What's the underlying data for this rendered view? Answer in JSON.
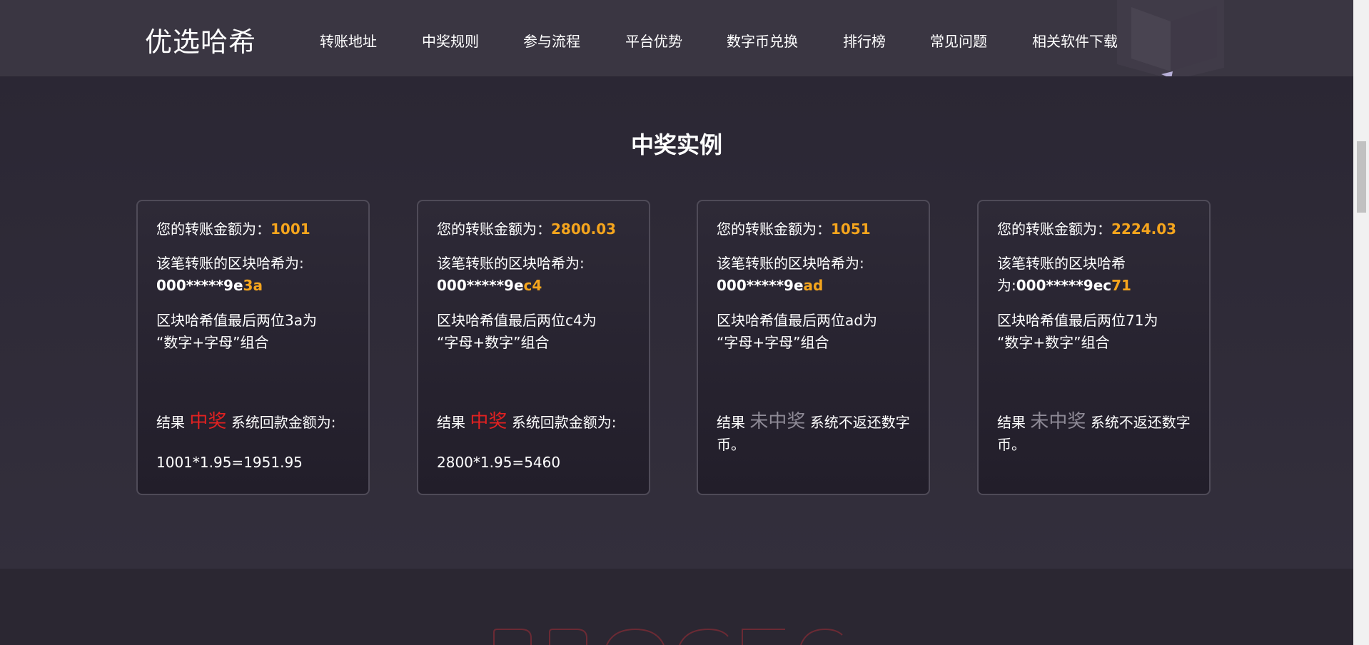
{
  "header": {
    "logo": "优选哈希",
    "nav": [
      "转账地址",
      "中奖规则",
      "参与流程",
      "平台优势",
      "数字币兑换",
      "排行榜",
      "常见问题",
      "相关软件下载"
    ]
  },
  "cases": {
    "title": "中奖实例",
    "cards": [
      {
        "amount_label": "您的转账金额为：",
        "amount": "1001",
        "hash_label": "该笔转账的区块哈希为:",
        "hash_prefix": "000*****9e",
        "hash_tail": "3a",
        "desc1": "区块哈希值最后两位3a为",
        "desc2": "“数字+字母”组合",
        "result_prefix": "结果 ",
        "result_word": "中奖",
        "result_suffix": " 系统回款金额为:",
        "formula": "1001*1.95=1951.95"
      },
      {
        "amount_label": "您的转账金额为：",
        "amount": "2800.03",
        "hash_label": "该笔转账的区块哈希为:",
        "hash_prefix": "000*****9e",
        "hash_tail": "c4",
        "desc1": "区块哈希值最后两位c4为",
        "desc2": "“字母+数字”组合",
        "result_prefix": "结果 ",
        "result_word": "中奖",
        "result_suffix": " 系统回款金额为:",
        "formula": "2800*1.95=5460"
      },
      {
        "amount_label": "您的转账金额为：",
        "amount": "1051",
        "hash_label": "该笔转账的区块哈希为:",
        "hash_prefix": "000*****9e",
        "hash_tail": "ad",
        "desc1": "区块哈希值最后两位ad为",
        "desc2": "“字母+字母”组合",
        "result_prefix": "结果 ",
        "result_word": "未中奖",
        "result_suffix": " 系统不返还数字",
        "result_suffix2": "币。"
      },
      {
        "amount_label": "您的转账金额为：",
        "amount": "2224.03",
        "hash_label": "该笔转账的区块哈希",
        "hash_label2": "为:",
        "hash_prefix": "000*****9ec",
        "hash_tail": "71",
        "desc1": "区块哈希值最后两位71为",
        "desc2": "“数字+数字”组合",
        "result_prefix": "结果 ",
        "result_word": "未中奖",
        "result_suffix": " 系统不返还数字",
        "result_suffix2": "币。"
      }
    ]
  },
  "colors": {
    "accent": "#f5a51d",
    "win": "#e12121",
    "lose": "#8e8a96",
    "background": "#2e2a38",
    "header": "#3a3642"
  }
}
